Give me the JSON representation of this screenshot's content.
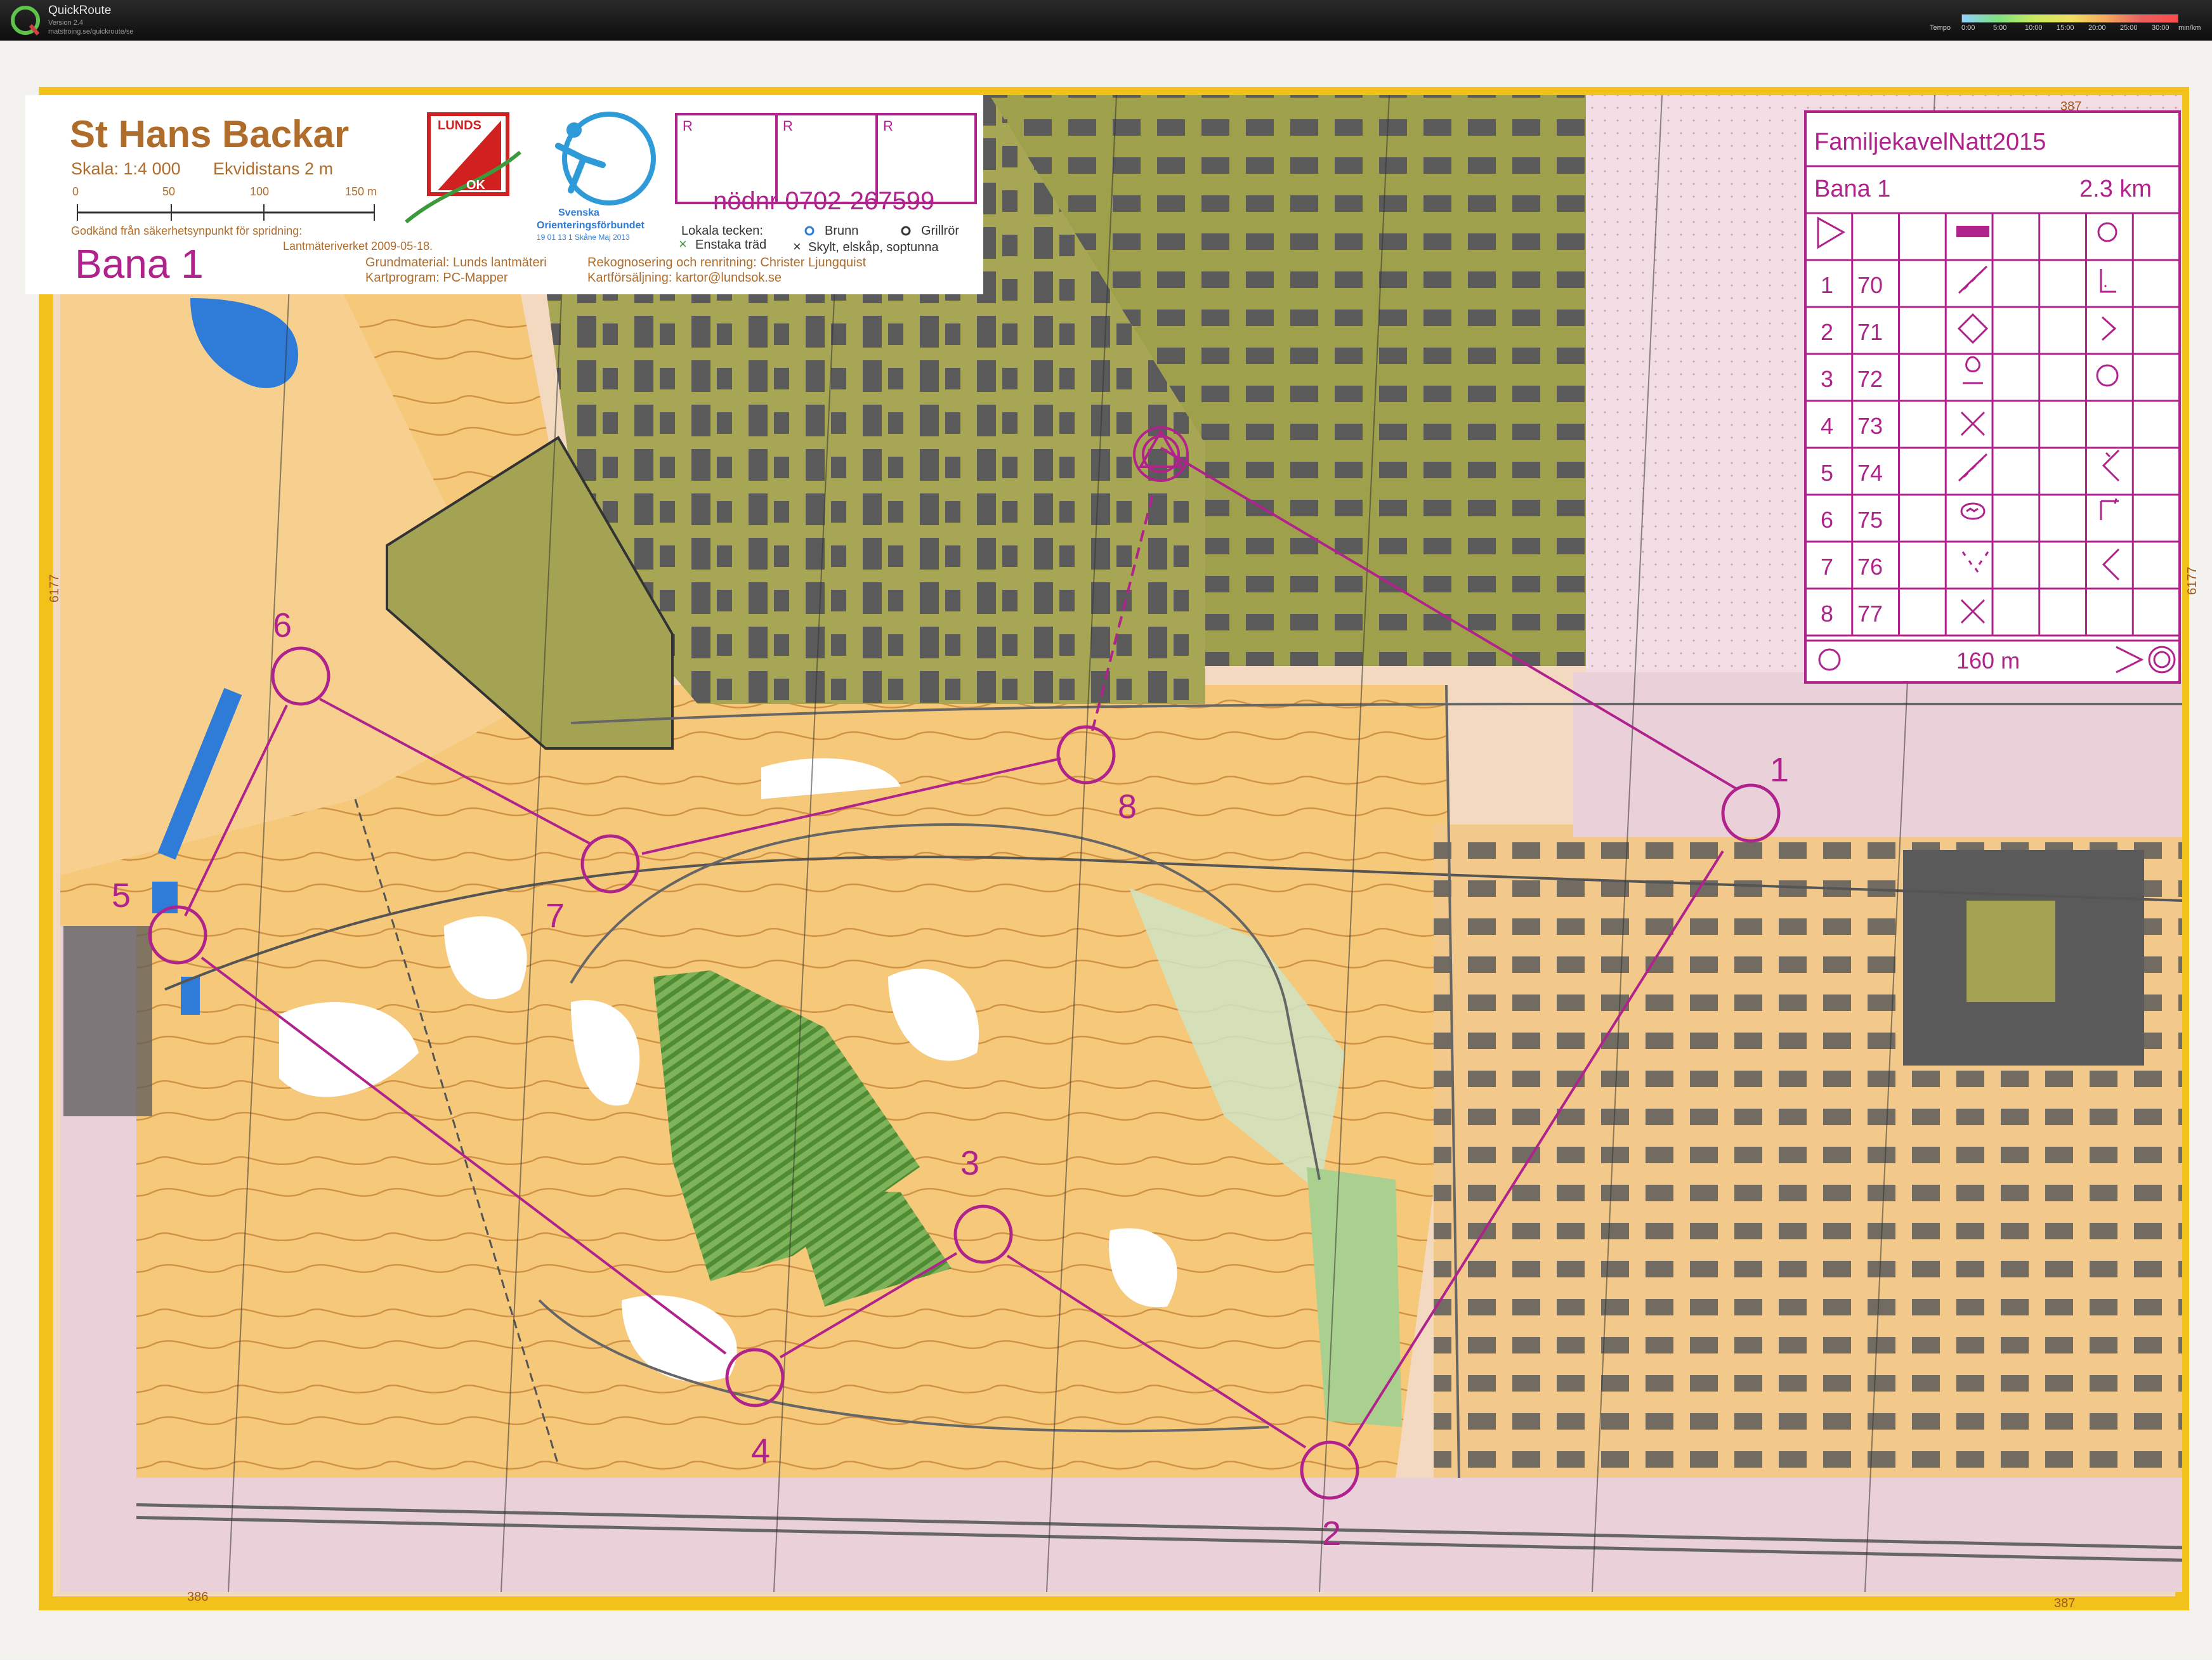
{
  "app": {
    "name": "QuickRoute",
    "version": "Version 2.4",
    "url": "matstroing.se/quickroute/se",
    "tempo_label": "Tempo",
    "tempo_ticks": [
      "0:00",
      "5:00",
      "10:00",
      "15:00",
      "20:00",
      "25:00",
      "30:00",
      "min/km"
    ]
  },
  "map_header": {
    "title": "St Hans Backar",
    "scale": "Skala: 1:4 000",
    "contour": "Ekvidistans 2 m",
    "scale_ticks": [
      "0",
      "50",
      "100",
      "150 m"
    ],
    "approval_line1": "Godkänd från säkerhetsynpunkt för spridning:",
    "approval_line2": "Lantmäteriverket 2009-05-18.",
    "course_name": "Bana 1",
    "base_material": "Grundmaterial: Lunds lantmäteri",
    "software": "Kartprogram: PC-Mapper",
    "club_logo_text_top": "LUNDS",
    "club_logo_text_bottom": "OK",
    "federation_line1": "Svenska",
    "federation_line2": "Orienteringsförbundet",
    "federation_line3": "19 01 13 1   Skåne Maj 2013",
    "r_boxes": [
      "R",
      "R",
      "R"
    ],
    "emergency": "nödnr 0702-267599",
    "legend_title": "Lokala tecken:",
    "legend_brunn": "Brunn",
    "legend_grillror": "Grillrör",
    "legend_enstaka": "Enstaka träd",
    "legend_skylt": "Skylt, elskåp, soptunna",
    "recon": "Rekognosering och renritning: Christer Ljungquist",
    "sales": "Kartförsäljning: kartor@lundsok.se"
  },
  "grid_labels": {
    "top_left": "386",
    "top_right": "387",
    "bottom_left": "386",
    "bottom_right": "387",
    "side_left": "6177",
    "side_right": "6177"
  },
  "control_card": {
    "event": "FamiljekavelNatt2015",
    "course": "Bana 1",
    "length": "2.3 km",
    "rows": [
      {
        "num": "1",
        "code": "70"
      },
      {
        "num": "2",
        "code": "71"
      },
      {
        "num": "3",
        "code": "72"
      },
      {
        "num": "4",
        "code": "73"
      },
      {
        "num": "5",
        "code": "74"
      },
      {
        "num": "6",
        "code": "75"
      },
      {
        "num": "7",
        "code": "76"
      },
      {
        "num": "8",
        "code": "77"
      }
    ],
    "finish_distance": "160 m"
  },
  "course": {
    "color": "#b0228c",
    "start_label": "start",
    "controls": [
      {
        "label": "1"
      },
      {
        "label": "2"
      },
      {
        "label": "3"
      },
      {
        "label": "4"
      },
      {
        "label": "5"
      },
      {
        "label": "6"
      },
      {
        "label": "7"
      },
      {
        "label": "8"
      }
    ]
  },
  "colors": {
    "open_land": "#f5c87a",
    "urban_pink": "#f0d8e0",
    "forest_white": "#ffffff",
    "green": "#6ea34a",
    "olive": "#9ea04a",
    "building": "#5a5a5a",
    "water": "#2f7cd8",
    "contour": "#b5661a",
    "title_brown": "#b06c2a",
    "border_yellow": "#f2c21a"
  }
}
